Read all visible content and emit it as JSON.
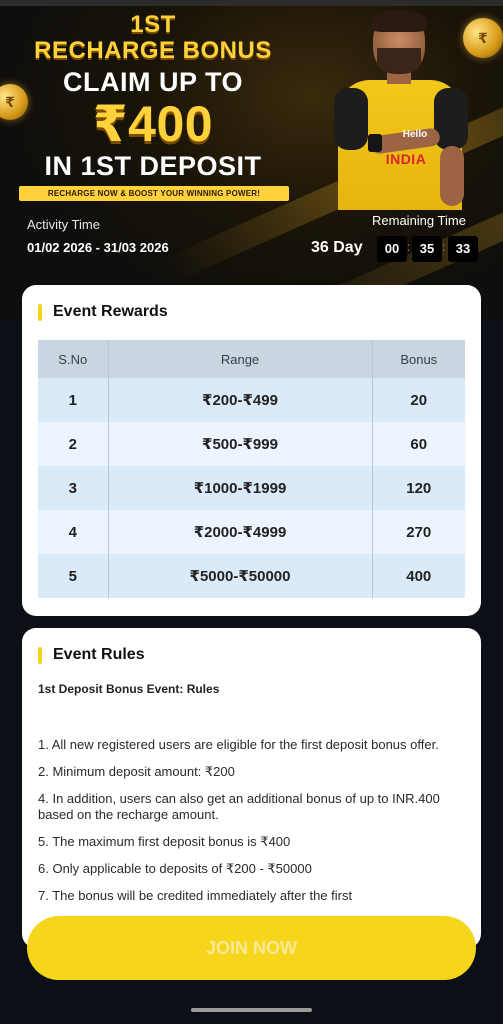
{
  "banner": {
    "line1": "1ST",
    "line2": "RECHARGE BONUS",
    "line3": "CLAIM UP TO",
    "amount": "₹400",
    "line5": "IN 1ST DEPOSIT",
    "tagline": "RECHARGE NOW & BOOST YOUR WINNING POWER!",
    "jersey_logo": "Hello",
    "jersey_country": "INDIA"
  },
  "activity": {
    "label": "Activity Time",
    "value": "01/02 2026 - 31/03 2026"
  },
  "remaining": {
    "label": "Remaining Time",
    "days": "36 Day",
    "hours": "00",
    "minutes": "35",
    "seconds": "33"
  },
  "rewards": {
    "title": "Event Rewards",
    "headers": {
      "sno": "S.No",
      "range": "Range",
      "bonus": "Bonus"
    },
    "rows": [
      {
        "sno": "1",
        "range": "₹200-₹499",
        "bonus": "20"
      },
      {
        "sno": "2",
        "range": "₹500-₹999",
        "bonus": "60"
      },
      {
        "sno": "3",
        "range": "₹1000-₹1999",
        "bonus": "120"
      },
      {
        "sno": "4",
        "range": "₹2000-₹4999",
        "bonus": "270"
      },
      {
        "sno": "5",
        "range": "₹5000-₹50000",
        "bonus": "400"
      }
    ]
  },
  "rules": {
    "title": "Event Rules",
    "subtitle": "1st Deposit Bonus Event: Rules",
    "items": [
      "1. All new registered users are eligible for the first deposit bonus offer.",
      "2. Minimum deposit amount: ₹200",
      "4. In addition, users can also get an additional bonus of up to INR.400 based on the recharge amount.",
      "5. The maximum first deposit bonus is ₹400",
      "6. Only applicable to deposits of ₹200 - ₹50000",
      "7. The bonus will be credited immediately after the first"
    ]
  },
  "join_button": "JOIN NOW"
}
